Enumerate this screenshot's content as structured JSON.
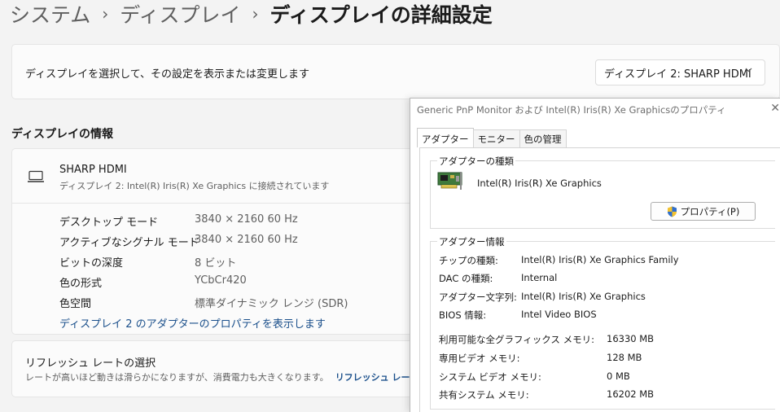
{
  "breadcrumb": {
    "item1": "システム",
    "item2": "ディスプレイ",
    "current": "ディスプレイの詳細設定",
    "separator": "›"
  },
  "select_card": {
    "description": "ディスプレイを選択して、その設定を表示または変更します",
    "dropdown_value": "ディスプレイ 2: SHARP HDMI"
  },
  "info_section": {
    "title": "ディスプレイの情報",
    "display_name": "SHARP HDMI",
    "display_sub": "ディスプレイ 2: Intel(R) Iris(R) Xe Graphics に接続されています",
    "specs": [
      {
        "label": "デスクトップ モード",
        "value": "3840 × 2160 60 Hz"
      },
      {
        "label": "アクティブなシグナル モード",
        "value": "3840 × 2160 60 Hz"
      },
      {
        "label": "ビットの深度",
        "value": "8 ビット"
      },
      {
        "label": "色の形式",
        "value": "YCbCr420"
      },
      {
        "label": "色空間",
        "value": "標準ダイナミック レンジ (SDR)"
      }
    ],
    "adapter_link": "ディスプレイ 2 のアダプターのプロパティを表示します"
  },
  "refresh": {
    "title": "リフレッシュ レートの選択",
    "description": "レートが高いほど動きは滑らかになりますが、消費電力も大きくなります。",
    "link": "リフレッシュ レートの詳細"
  },
  "dialog": {
    "title": "Generic PnP Monitor および Intel(R) Iris(R) Xe Graphicsのプロパティ",
    "close": "✕",
    "tabs": [
      "アダプター",
      "モニター",
      "色の管理"
    ],
    "adapter_type_label": "アダプターの種類",
    "adapter_name": "Intel(R) Iris(R) Xe Graphics",
    "properties_button": "プロパティ(P)",
    "adapter_info_label": "アダプター情報",
    "adapter_info": [
      {
        "key": "チップの種類:",
        "value": "Intel(R) Iris(R) Xe Graphics Family"
      },
      {
        "key": "DAC の種類:",
        "value": "Internal"
      },
      {
        "key": "アダプター文字列:",
        "value": "Intel(R) Iris(R) Xe Graphics"
      },
      {
        "key": "BIOS 情報:",
        "value": "Intel Video BIOS"
      }
    ],
    "memory_info": [
      {
        "key": "利用可能な全グラフィックス メモリ:",
        "value": "16330 MB"
      },
      {
        "key": "専用ビデオ メモリ:",
        "value": "128 MB"
      },
      {
        "key": "システム ビデオ メモリ:",
        "value": "0 MB"
      },
      {
        "key": "共有システム メモリ:",
        "value": "16202 MB"
      }
    ]
  },
  "icons": {
    "monitor": "monitor-icon",
    "chevron": "chevron-down-icon",
    "shield": "shield-icon",
    "card": "graphics-card-icon"
  },
  "colors": {
    "link": "#1a4f8b",
    "background": "#f3f3f3",
    "card": "#fbfbfb"
  }
}
